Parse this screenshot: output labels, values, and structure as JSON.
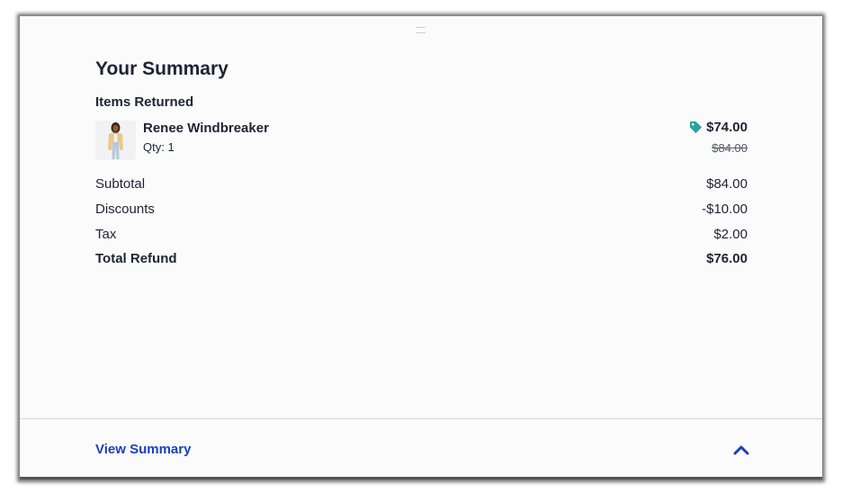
{
  "summary": {
    "title": "Your Summary",
    "items_label": "Items Returned"
  },
  "item": {
    "name": "Renee Windbreaker",
    "qty": "Qty: 1",
    "price": "$74.00",
    "original_price": "$84.00",
    "icon": "price-tag-icon"
  },
  "totals": {
    "subtotal_label": "Subtotal",
    "subtotal_value": "$84.00",
    "discounts_label": "Discounts",
    "discounts_value": "-$10.00",
    "tax_label": "Tax",
    "tax_value": "$2.00",
    "total_label": "Total Refund",
    "total_value": "$76.00"
  },
  "footer": {
    "view_summary_label": "View Summary",
    "toggle_icon": "chevron-up-icon"
  },
  "colors": {
    "accent": "#1c3fb7",
    "tag": "#2aa39a",
    "text": "#1d2433"
  }
}
